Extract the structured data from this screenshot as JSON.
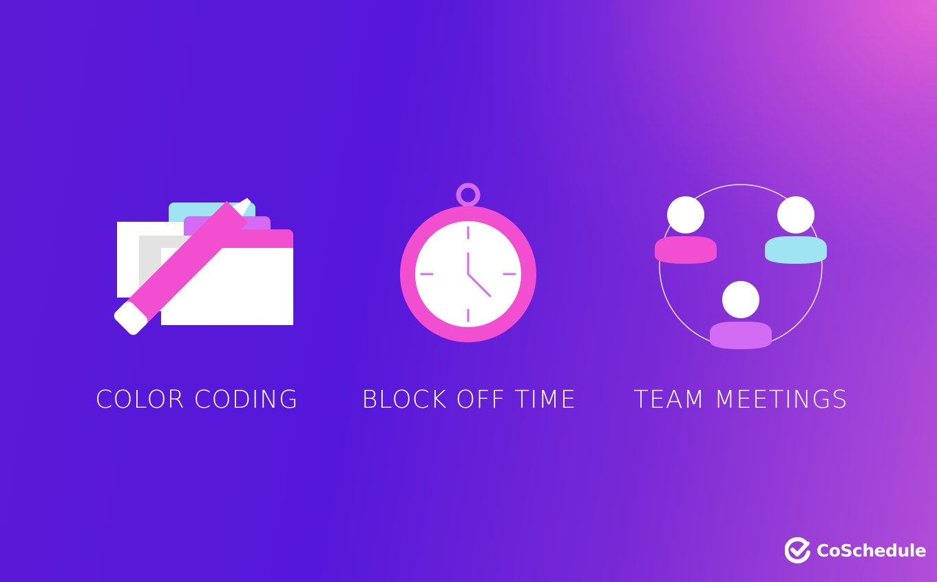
{
  "labels": {
    "color_coding": "COLOR CODING",
    "block_off_time": "BLOCK OFF TIME",
    "team_meetings": "TEAM MEETINGS"
  },
  "brand": {
    "name": "CoSchedule",
    "icon": "coschedule-check-logo-icon"
  },
  "icons": {
    "color_coding": "folders-and-highlighter-icon",
    "block_off_time": "stopwatch-icon",
    "team_meetings": "team-people-circle-icon"
  },
  "colors": {
    "background_start": "#5517da",
    "background_corner": "#e864d7",
    "pink": "#f24fd0",
    "light_purple": "#d36bf5",
    "light_blue": "#9ee4f2",
    "white": "#ffffff",
    "gray": "#e3e3e3"
  }
}
